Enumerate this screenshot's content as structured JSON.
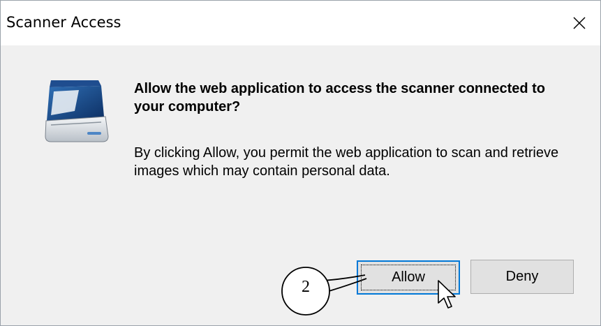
{
  "window": {
    "title": "Scanner Access"
  },
  "dialog": {
    "heading": "Allow the web application to access the scanner connected to your computer?",
    "description": "By clicking Allow, you permit the web application to scan and retrieve images which may contain personal data."
  },
  "buttons": {
    "allow": "Allow",
    "deny": "Deny"
  },
  "annotation": {
    "step": "2"
  },
  "icons": {
    "close": "close-icon",
    "scanner": "scanner-icon",
    "cursor": "mouse-pointer-icon"
  },
  "colors": {
    "focus_border": "#0078d7",
    "dialog_bg": "#f0f0f0",
    "button_bg": "#e1e1e1"
  }
}
